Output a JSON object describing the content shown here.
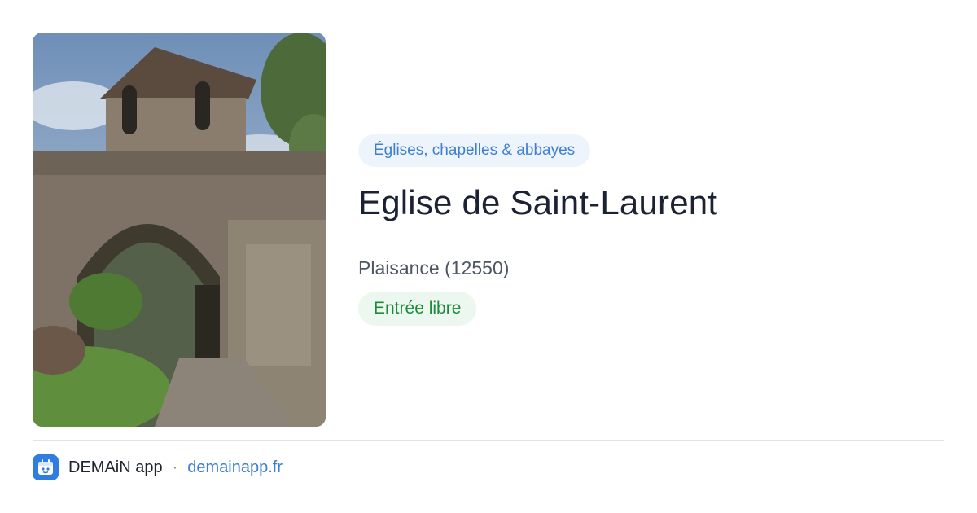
{
  "card": {
    "category": "Églises, chapelles & abbayes",
    "title": "Eglise de Saint-Laurent",
    "location": "Plaisance (12550)",
    "status": "Entrée libre"
  },
  "footer": {
    "app_name": "DEMAiN app",
    "separator": "·",
    "domain": "demainapp.fr"
  },
  "colors": {
    "accent": "#3d7fd3",
    "category_bg": "#eef4fc",
    "status_text": "#1e8a3c",
    "status_bg": "#ecf8ef",
    "title": "#1a2233"
  },
  "icons": {
    "app_icon": "demain-app-icon"
  }
}
